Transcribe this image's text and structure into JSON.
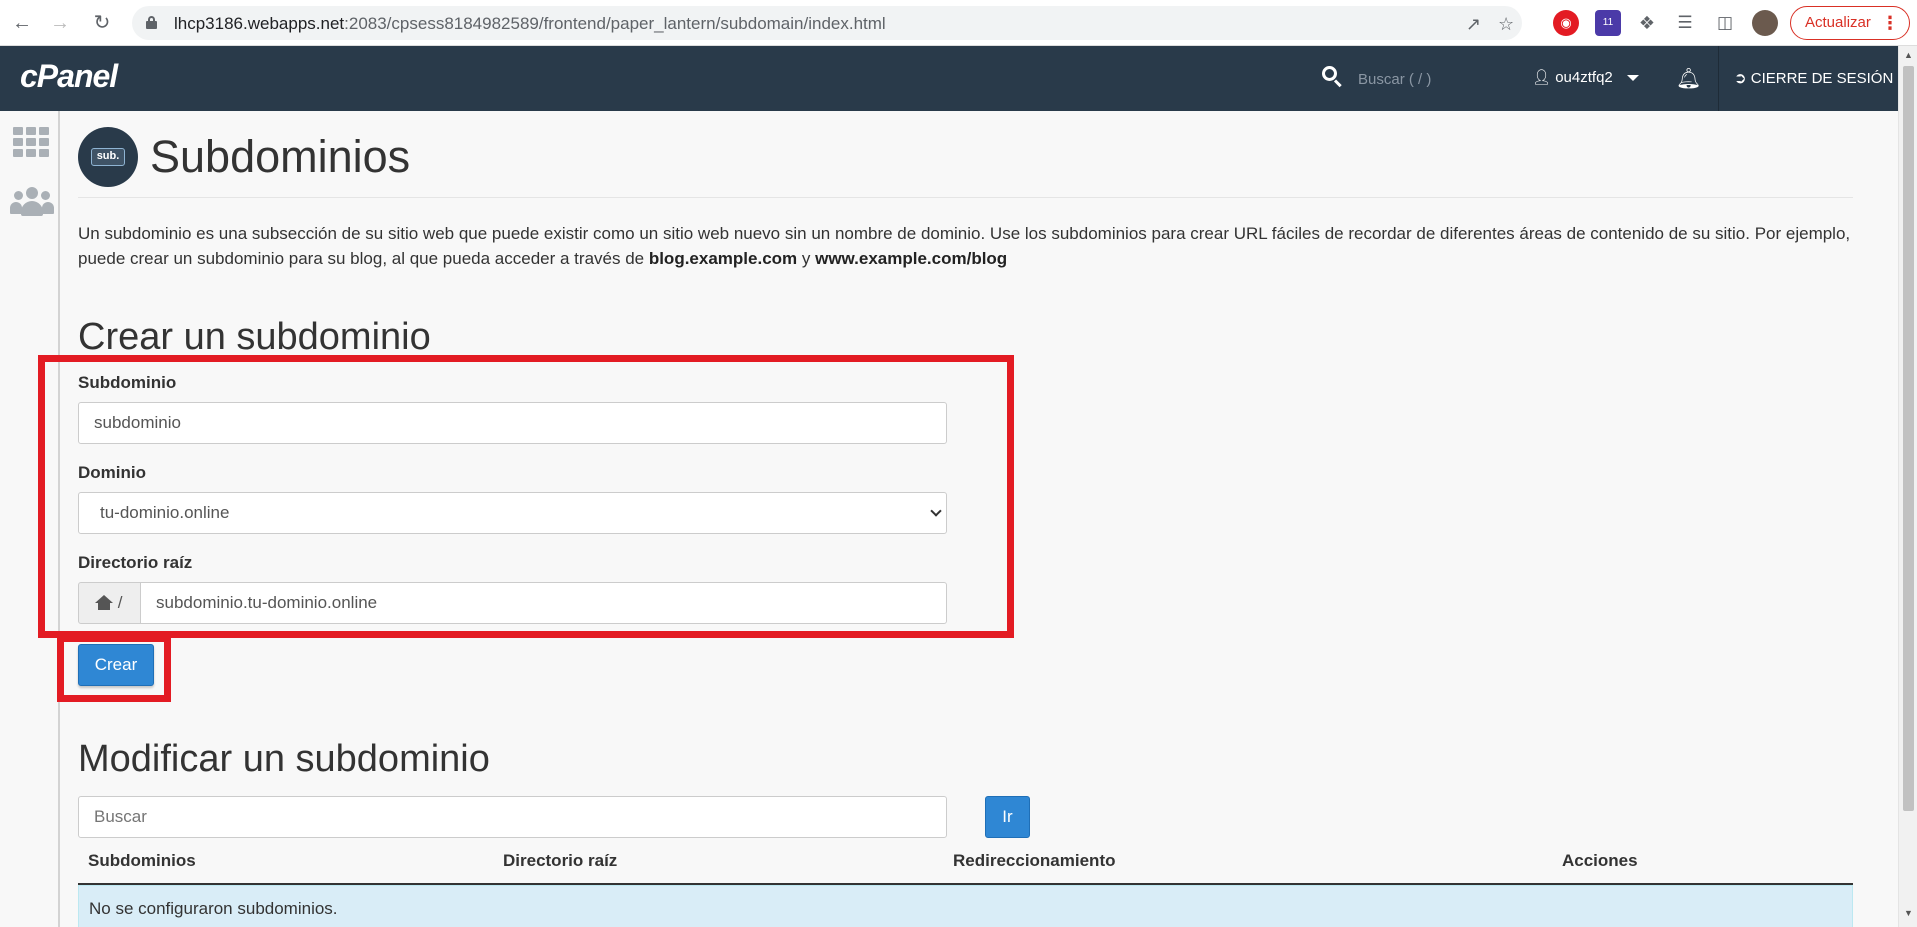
{
  "browser": {
    "url_host": "lhcp3186.webapps.net",
    "url_rest": ":2083/cpsess8184982589/frontend/paper_lantern/subdomain/index.html",
    "update_label": "Actualizar",
    "extension_badge": "11"
  },
  "cpanel": {
    "logo": "cPanel",
    "search_placeholder": "Buscar ( / )",
    "username": "ou4ztfq2",
    "logout_label": "CIERRE DE SESIÓN"
  },
  "page": {
    "icon_label": "sub.",
    "title": "Subdominios",
    "description_part1": "Un subdominio es una subsección de su sitio web que puede existir como un sitio web nuevo sin un nombre de dominio. Use los subdominios para crear URL fáciles de recordar de diferentes áreas de contenido de su sitio. Por ejemplo, puede crear un subdominio para su blog, al que pueda acceder a través de ",
    "description_example1": "blog.example.com",
    "description_and": " y ",
    "description_example2": "www.example.com/blog"
  },
  "create_form": {
    "heading": "Crear un subdominio",
    "subdomain_label": "Subdominio",
    "subdomain_value": "subdominio",
    "domain_label": "Dominio",
    "domain_selected": "tu-dominio.online",
    "docroot_label": "Directorio raíz",
    "docroot_prefix": "/",
    "docroot_value": "subdominio.tu-dominio.online",
    "submit_label": "Crear"
  },
  "modify_section": {
    "heading": "Modificar un subdominio",
    "search_placeholder": "Buscar",
    "go_label": "Ir",
    "columns": [
      "Subdominios",
      "Directorio raíz",
      "Redireccionamiento",
      "Acciones"
    ],
    "empty_message": "No se configuraron subdominios."
  },
  "colors": {
    "header_bg": "#293a4a",
    "primary_button": "#2f87d4",
    "highlight_red": "#e31b23",
    "info_row": "#d9edf7"
  }
}
